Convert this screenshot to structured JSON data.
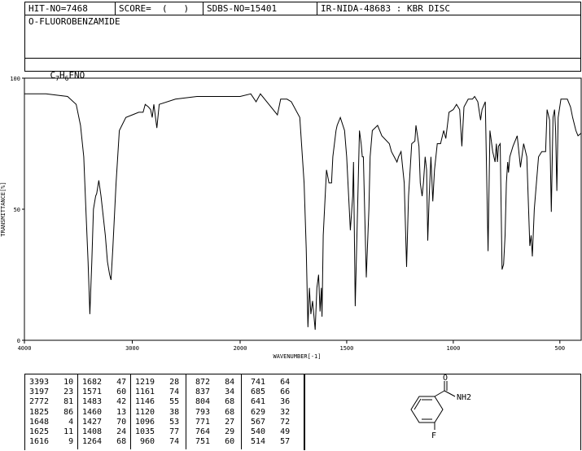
{
  "header": {
    "hit": "HIT-NO=7468",
    "score": "SCORE=  (   )",
    "sdbs": "SDBS-NO=15401",
    "ir": "IR-NIDA-48683 : KBR DISC",
    "compound": "O-FLUOROBENZAMIDE",
    "formula_parts": [
      "C",
      "7",
      "H",
      "6",
      "FNO"
    ]
  },
  "chart_data": {
    "type": "line",
    "xlabel": "WAVENUMBER[-1]",
    "ylabel": "TRANSMITTANCE[%]",
    "xlim": [
      4000,
      400
    ],
    "ylim": [
      0,
      100
    ],
    "x_ticks": [
      4000,
      3000,
      2000,
      1500,
      1000,
      500
    ],
    "y_ticks": [
      0,
      50,
      100
    ],
    "series": [
      {
        "points": [
          [
            4000,
            94
          ],
          [
            3800,
            94
          ],
          [
            3600,
            93
          ],
          [
            3520,
            90
          ],
          [
            3480,
            82
          ],
          [
            3450,
            70
          ],
          [
            3430,
            50
          ],
          [
            3410,
            30
          ],
          [
            3393,
            10
          ],
          [
            3375,
            30
          ],
          [
            3360,
            50
          ],
          [
            3340,
            55
          ],
          [
            3330,
            56
          ],
          [
            3310,
            61
          ],
          [
            3290,
            55
          ],
          [
            3250,
            40
          ],
          [
            3230,
            30
          ],
          [
            3210,
            25
          ],
          [
            3197,
            23
          ],
          [
            3180,
            35
          ],
          [
            3150,
            60
          ],
          [
            3120,
            80
          ],
          [
            3060,
            85
          ],
          [
            3000,
            86
          ],
          [
            2940,
            87
          ],
          [
            2900,
            87
          ],
          [
            2880,
            90
          ],
          [
            2850,
            89
          ],
          [
            2830,
            88
          ],
          [
            2815,
            85
          ],
          [
            2800,
            90
          ],
          [
            2772,
            81
          ],
          [
            2750,
            90
          ],
          [
            2600,
            92
          ],
          [
            2400,
            93
          ],
          [
            2200,
            93
          ],
          [
            2000,
            93
          ],
          [
            1950,
            94
          ],
          [
            1925,
            91
          ],
          [
            1905,
            94
          ],
          [
            1825,
            86
          ],
          [
            1810,
            92
          ],
          [
            1780,
            92
          ],
          [
            1760,
            91
          ],
          [
            1720,
            85
          ],
          [
            1700,
            60
          ],
          [
            1690,
            35
          ],
          [
            1682,
            5
          ],
          [
            1675,
            20
          ],
          [
            1668,
            10
          ],
          [
            1660,
            15
          ],
          [
            1648,
            4
          ],
          [
            1640,
            20
          ],
          [
            1632,
            25
          ],
          [
            1625,
            11
          ],
          [
            1619,
            20
          ],
          [
            1616,
            9
          ],
          [
            1610,
            40
          ],
          [
            1595,
            65
          ],
          [
            1583,
            60
          ],
          [
            1571,
            60
          ],
          [
            1565,
            70
          ],
          [
            1550,
            80
          ],
          [
            1545,
            82
          ],
          [
            1530,
            85
          ],
          [
            1510,
            80
          ],
          [
            1500,
            70
          ],
          [
            1483,
            42
          ],
          [
            1472,
            55
          ],
          [
            1468,
            68
          ],
          [
            1460,
            13
          ],
          [
            1452,
            40
          ],
          [
            1440,
            80
          ],
          [
            1432,
            75
          ],
          [
            1427,
            70
          ],
          [
            1422,
            70
          ],
          [
            1408,
            24
          ],
          [
            1396,
            50
          ],
          [
            1390,
            70
          ],
          [
            1380,
            80
          ],
          [
            1355,
            82
          ],
          [
            1335,
            78
          ],
          [
            1300,
            75
          ],
          [
            1290,
            72
          ],
          [
            1277,
            70
          ],
          [
            1264,
            68
          ],
          [
            1257,
            70
          ],
          [
            1245,
            72
          ],
          [
            1230,
            60
          ],
          [
            1219,
            28
          ],
          [
            1210,
            55
          ],
          [
            1195,
            75
          ],
          [
            1180,
            76
          ],
          [
            1175,
            82
          ],
          [
            1168,
            78
          ],
          [
            1161,
            74
          ],
          [
            1155,
            60
          ],
          [
            1146,
            55
          ],
          [
            1140,
            60
          ],
          [
            1132,
            70
          ],
          [
            1125,
            65
          ],
          [
            1120,
            38
          ],
          [
            1113,
            55
          ],
          [
            1105,
            70
          ],
          [
            1096,
            53
          ],
          [
            1088,
            65
          ],
          [
            1075,
            75
          ],
          [
            1060,
            75
          ],
          [
            1045,
            80
          ],
          [
            1035,
            77
          ],
          [
            1020,
            87
          ],
          [
            1000,
            88
          ],
          [
            985,
            90
          ],
          [
            970,
            88
          ],
          [
            960,
            74
          ],
          [
            950,
            89
          ],
          [
            930,
            92
          ],
          [
            910,
            92
          ],
          [
            900,
            93
          ],
          [
            885,
            91
          ],
          [
            872,
            84
          ],
          [
            865,
            88
          ],
          [
            850,
            91
          ],
          [
            837,
            34
          ],
          [
            828,
            80
          ],
          [
            815,
            72
          ],
          [
            804,
            68
          ],
          [
            798,
            75
          ],
          [
            793,
            68
          ],
          [
            788,
            74
          ],
          [
            780,
            75
          ],
          [
            771,
            27
          ],
          [
            764,
            29
          ],
          [
            757,
            40
          ],
          [
            751,
            60
          ],
          [
            745,
            68
          ],
          [
            741,
            64
          ],
          [
            735,
            70
          ],
          [
            720,
            74
          ],
          [
            700,
            78
          ],
          [
            685,
            66
          ],
          [
            670,
            75
          ],
          [
            655,
            70
          ],
          [
            641,
            36
          ],
          [
            635,
            40
          ],
          [
            629,
            32
          ],
          [
            620,
            50
          ],
          [
            600,
            70
          ],
          [
            585,
            72
          ],
          [
            567,
            72
          ],
          [
            560,
            88
          ],
          [
            548,
            84
          ],
          [
            540,
            49
          ],
          [
            532,
            85
          ],
          [
            525,
            88
          ],
          [
            520,
            80
          ],
          [
            514,
            57
          ],
          [
            508,
            85
          ],
          [
            495,
            92
          ],
          [
            480,
            92
          ],
          [
            465,
            92
          ],
          [
            450,
            89
          ],
          [
            440,
            85
          ],
          [
            425,
            80
          ],
          [
            415,
            78
          ],
          [
            400,
            79
          ]
        ]
      }
    ]
  },
  "peaks": [
    [
      [
        3393,
        10
      ],
      [
        3197,
        23
      ],
      [
        2772,
        81
      ],
      [
        1825,
        86
      ],
      [
        1648,
        4
      ],
      [
        1625,
        11
      ],
      [
        1616,
        9
      ]
    ],
    [
      [
        1682,
        47
      ],
      [
        1571,
        60
      ],
      [
        1483,
        42
      ],
      [
        1460,
        13
      ],
      [
        1427,
        70
      ],
      [
        1408,
        24
      ],
      [
        1264,
        68
      ]
    ],
    [
      [
        1219,
        28
      ],
      [
        1161,
        74
      ],
      [
        1146,
        55
      ],
      [
        1120,
        38
      ],
      [
        1096,
        53
      ],
      [
        1035,
        77
      ],
      [
        960,
        74
      ]
    ],
    [
      [
        872,
        84
      ],
      [
        837,
        34
      ],
      [
        804,
        68
      ],
      [
        793,
        68
      ],
      [
        771,
        27
      ],
      [
        764,
        29
      ],
      [
        751,
        60
      ]
    ],
    [
      [
        741,
        64
      ],
      [
        685,
        66
      ],
      [
        641,
        36
      ],
      [
        629,
        32
      ],
      [
        567,
        72
      ],
      [
        540,
        49
      ],
      [
        514,
        57
      ]
    ]
  ],
  "structure": {
    "carbonyl_o": "O",
    "amine": "NH2",
    "fluorine": "F"
  }
}
